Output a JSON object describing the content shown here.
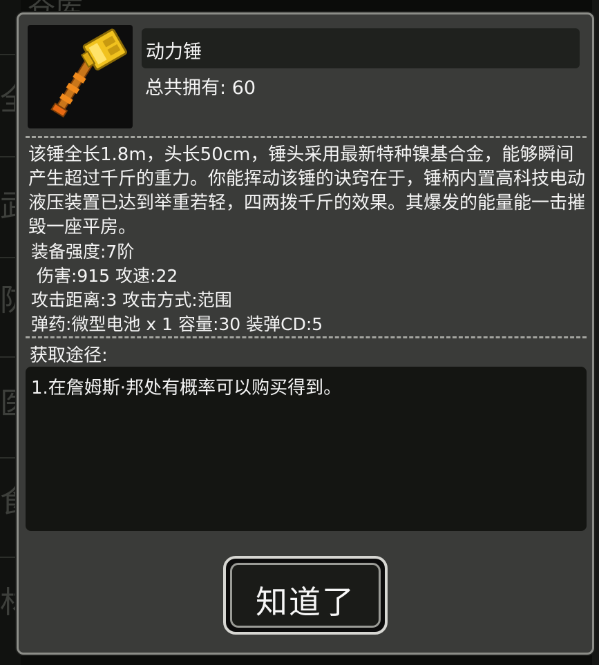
{
  "background": {
    "top_text": "仓库",
    "side_chars": [
      "全",
      "武",
      "防",
      "医",
      "食",
      "材"
    ]
  },
  "item": {
    "icon": "power-hammer-icon",
    "name": "动力锤",
    "owned_label": "总共拥有:",
    "owned_count": "60",
    "description": "该锤全长1.8m，头长50cm，锤头采用最新特种镍基合金，能够瞬间产生超过千斤的重力。你能挥动该锤的诀窍在于，锤柄内置高科技电动液压装置已达到举重若轻，四两拨千斤的效果。其爆发的能量能一击摧毁一座平房。",
    "stats": [
      "装备强度:7阶",
      " 伤害:915 攻速:22",
      "攻击距离:3 攻击方式:范围",
      "弹药:微型电池 x 1 容量:30 装弹CD:5"
    ]
  },
  "obtain": {
    "label": "获取途径:",
    "text": "1.在詹姆斯·邦处有概率可以购买得到。"
  },
  "button": {
    "ok_label": "知道了"
  },
  "colors": {
    "panel": "#3a3b39",
    "border": "#8c8d88",
    "dark_box": "#141512",
    "hammer": "#e8b21e"
  }
}
